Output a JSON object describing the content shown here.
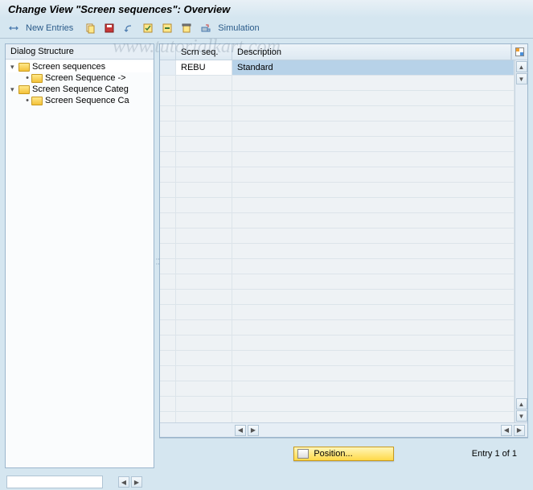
{
  "title": "Change View \"Screen sequences\": Overview",
  "toolbar": {
    "new_entries_label": "New Entries",
    "simulation_label": "Simulation"
  },
  "sidebar": {
    "header": "Dialog Structure",
    "nodes": {
      "screen_sequences": "Screen sequences",
      "screen_sequence_child": "Screen Sequence ->",
      "screen_sequence_categ": "Screen Sequence Categ",
      "screen_sequence_ca": "Screen Sequence Ca"
    }
  },
  "grid": {
    "columns": {
      "scrn_seq": "Scrn seq.",
      "description": "Description"
    },
    "rows": [
      {
        "scrn_seq": "REBU",
        "description": "Standard"
      }
    ]
  },
  "footer": {
    "position_label": "Position...",
    "entry_count": "Entry 1 of 1"
  },
  "watermark": "www.tutorialkart.com"
}
